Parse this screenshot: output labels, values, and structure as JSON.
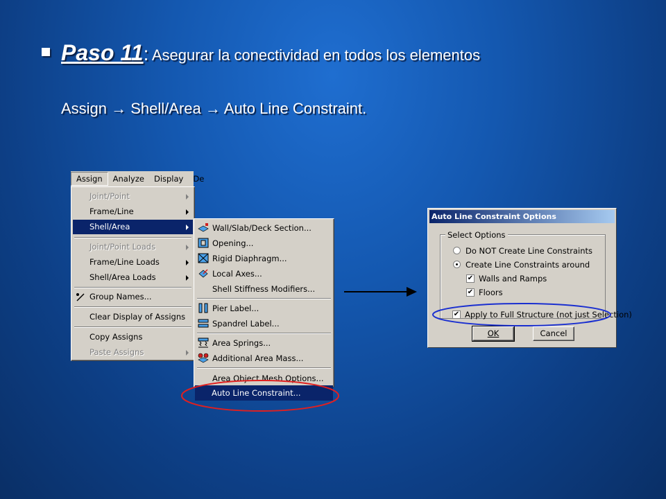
{
  "slide": {
    "paso": "Paso 11",
    "colon": ":",
    "title_rest": "Asegurar la conectividad en todos los elementos",
    "subtitle": "Assign → Shell/Area → Auto Line Constraint."
  },
  "menubar": {
    "items": [
      "Assign",
      "Analyze",
      "Display",
      "De"
    ]
  },
  "assign_menu": {
    "joint_point": "Joint/Point",
    "frame_line": "Frame/Line",
    "shell_area": "Shell/Area",
    "joint_point_loads": "Joint/Point Loads",
    "frame_line_loads": "Frame/Line Loads",
    "shell_area_loads": "Shell/Area Loads",
    "group_names": "Group Names...",
    "clear_display": "Clear Display of Assigns",
    "copy_assigns": "Copy Assigns",
    "paste_assigns": "Paste Assigns"
  },
  "shell_menu": {
    "wall_slab_deck": "Wall/Slab/Deck Section...",
    "opening": "Opening...",
    "rigid_diaphragm": "Rigid Diaphragm...",
    "local_axes": "Local Axes...",
    "shell_stiffness": "Shell Stiffness Modifiers...",
    "pier_label": "Pier Label...",
    "spandrel_label": "Spandrel Label...",
    "area_springs": "Area Springs...",
    "additional_mass": "Additional Area Mass...",
    "mesh_options": "Area Object Mesh Options...",
    "auto_line_constraint": "Auto Line Constraint..."
  },
  "dialog": {
    "title": "Auto Line Constraint Options",
    "group_label": "Select Options",
    "radio_not_create": "Do NOT Create Line Constraints",
    "radio_create": "Create Line Constraints around",
    "chk_walls": "Walls and Ramps",
    "chk_floors": "Floors",
    "chk_full": "Apply to Full Structure (not just Selection)",
    "ok": "OK",
    "cancel": "Cancel"
  },
  "colors": {
    "highlight_ellipse_red": "#e02020",
    "highlight_ellipse_blue": "#1a2fd0",
    "menu_select": "#0a246a"
  }
}
